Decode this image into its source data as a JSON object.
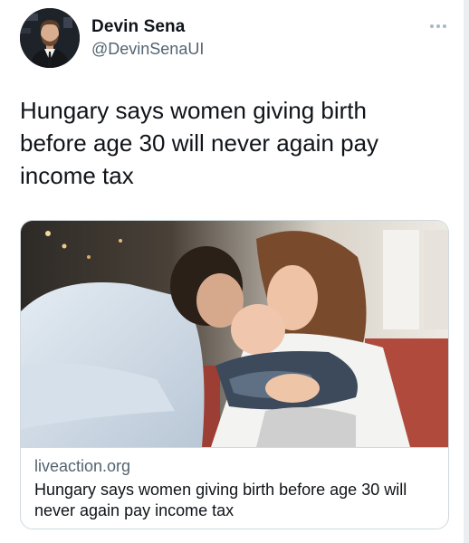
{
  "author": {
    "display_name": "Devin Sena",
    "handle": "@DevinSenaUI"
  },
  "tweet": {
    "text": "Hungary says women giving birth before age 30 will never again pay income tax"
  },
  "card": {
    "domain": "liveaction.org",
    "title": "Hungary says women giving birth before age 30 will never again pay income tax",
    "image_description_icon": "photo"
  },
  "icons": {
    "more": "more-horizontal-icon"
  },
  "colors": {
    "text_primary": "#0f1419",
    "text_secondary": "#536471",
    "border": "#cfd9de",
    "background": "#ffffff"
  }
}
